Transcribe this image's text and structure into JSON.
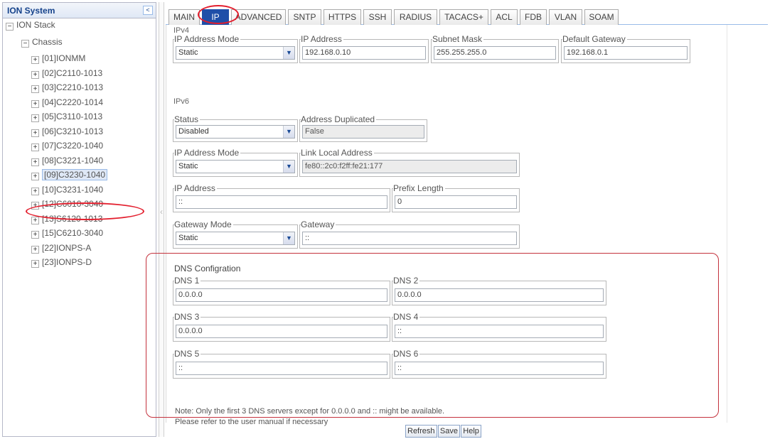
{
  "left": {
    "title": "ION System",
    "collapse_glyph": "<",
    "root": "ION Stack",
    "chassis": "Chassis",
    "devices": [
      "[01]IONMM",
      "[02]C2110-1013",
      "[03]C2210-1013",
      "[04]C2220-1014",
      "[05]C3110-1013",
      "[06]C3210-1013",
      "[07]C3220-1040",
      "[08]C3221-1040",
      "[09]C3230-1040",
      "[10]C3231-1040",
      "[12]C6010-3040",
      "[13]S6120-1013",
      "[15]C6210-3040",
      "[22]IONPS-A",
      "[23]IONPS-D"
    ],
    "selected_index": 8
  },
  "tabs": [
    "MAIN",
    "IP",
    "ADVANCED",
    "SNTP",
    "HTTPS",
    "SSH",
    "RADIUS",
    "TACACS+",
    "ACL",
    "FDB",
    "VLAN",
    "SOAM"
  ],
  "active_tab": "IP",
  "ipv4": {
    "section": "IPv4",
    "mode_label": "IP Address Mode",
    "mode_value": "Static",
    "addr_label": "IP Address",
    "addr_value": "192.168.0.10",
    "mask_label": "Subnet Mask",
    "mask_value": "255.255.255.0",
    "gw_label": "Default Gateway",
    "gw_value": "192.168.0.1"
  },
  "ipv6": {
    "section": "IPv6",
    "status_label": "Status",
    "status_value": "Disabled",
    "dup_label": "Address Duplicated",
    "dup_value": "False",
    "mode_label": "IP Address Mode",
    "mode_value": "Static",
    "lla_label": "Link Local Address",
    "lla_value": "fe80::2c0:f2ff:fe21:177",
    "addr_label": "IP Address",
    "addr_value": "::",
    "prefix_label": "Prefix Length",
    "prefix_value": "0",
    "gwmode_label": "Gateway Mode",
    "gwmode_value": "Static",
    "gw_label": "Gateway",
    "gw_value": "::"
  },
  "dns": {
    "title": "DNS Configration",
    "entries": [
      {
        "label": "DNS 1",
        "value": "0.0.0.0"
      },
      {
        "label": "DNS 2",
        "value": "0.0.0.0"
      },
      {
        "label": "DNS 3",
        "value": "0.0.0.0"
      },
      {
        "label": "DNS 4",
        "value": "::"
      },
      {
        "label": "DNS 5",
        "value": "::"
      },
      {
        "label": "DNS 6",
        "value": "::"
      }
    ],
    "note_line1": "Note: Only the first 3 DNS servers except for 0.0.0.0 and :: might be available.",
    "note_line2": "Please refer to the user manual if necessary"
  },
  "buttons": {
    "refresh": "Refresh",
    "save": "Save",
    "help": "Help"
  },
  "colors": {
    "highlight_ring": "#e31e2d",
    "active_tab": "#1f4fa8",
    "dns_box": "#c4323d"
  }
}
